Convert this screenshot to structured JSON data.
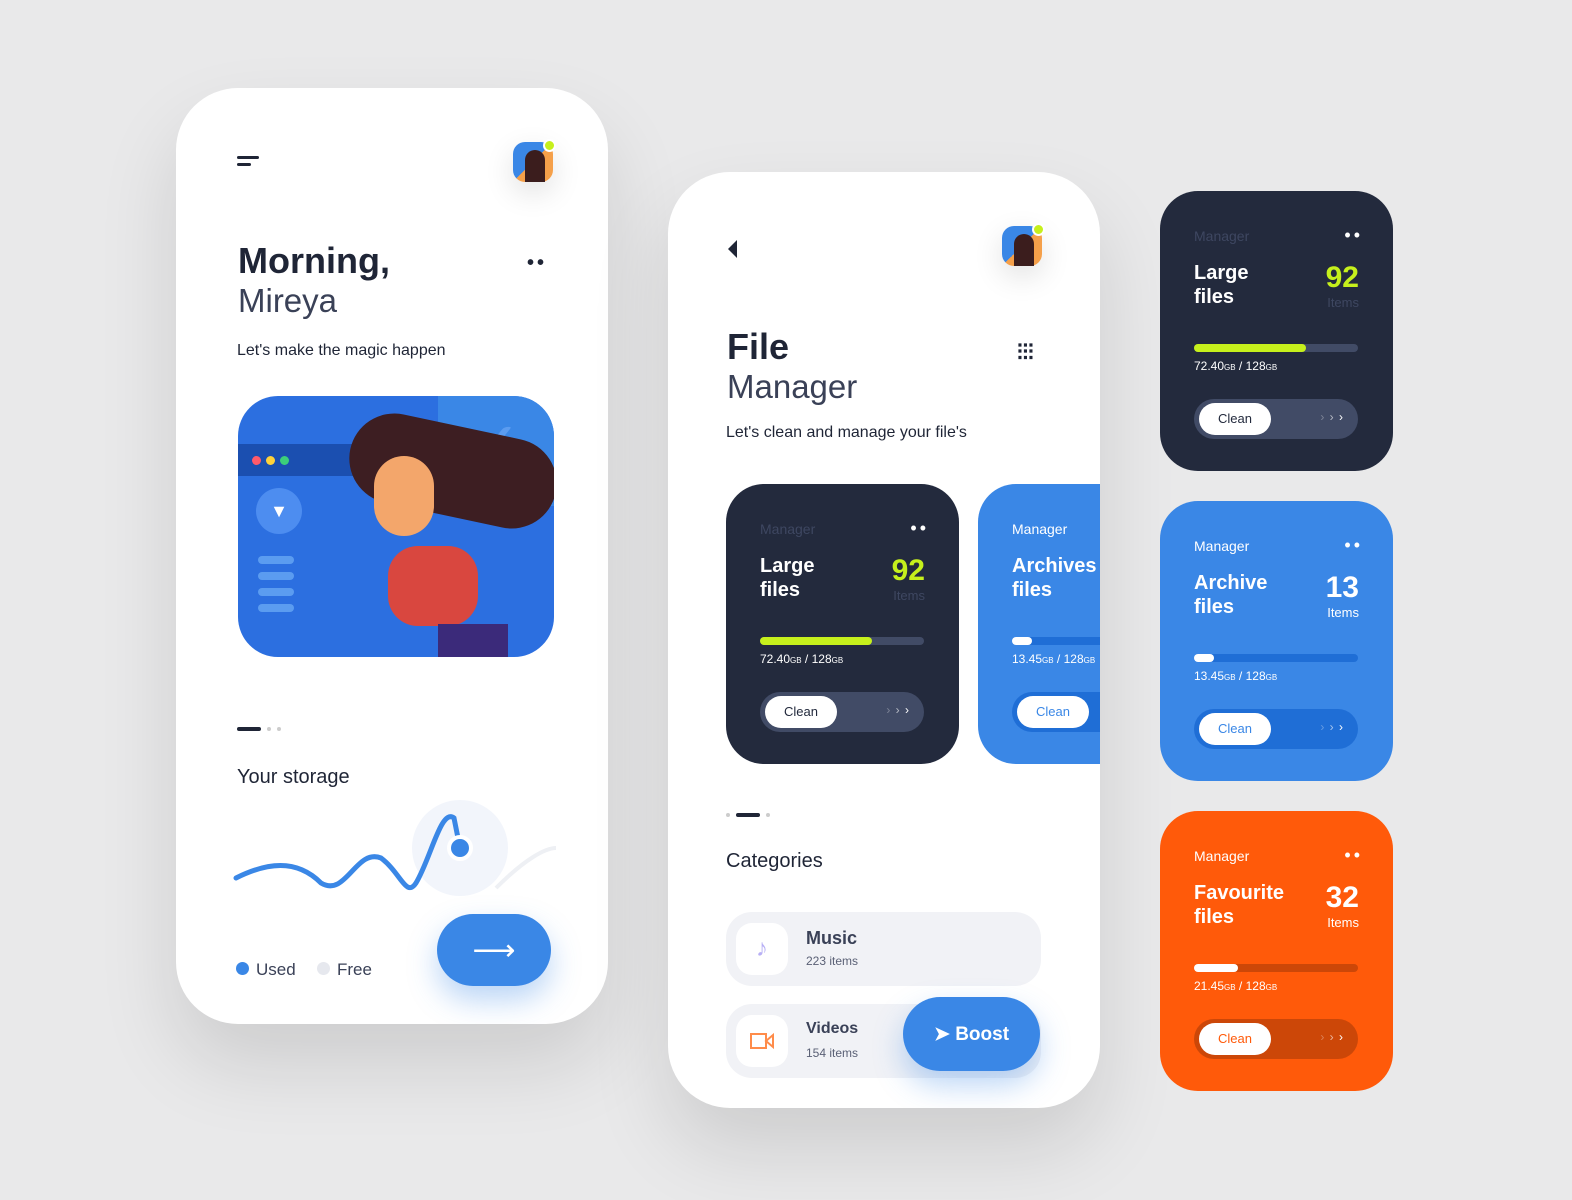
{
  "colors": {
    "dark": "#232a3d",
    "blue": "#3a87e6",
    "orange": "#ff5a0a",
    "lime": "#c6f01c"
  },
  "home": {
    "greeting_bold": "Morning,",
    "greeting_name": "Mireya",
    "subtitle": "Let's make the magic happen",
    "storage_title": "Your storage",
    "legend": [
      {
        "label": "Used",
        "color": "#3a87e6"
      },
      {
        "label": "Free",
        "color": "#e6e8ee"
      }
    ],
    "icons": {
      "menu": "menu-icon",
      "next": "arrow-right-icon",
      "more": "more-dots-icon"
    },
    "pager_active": 0
  },
  "manager": {
    "title_bold": "File",
    "title_light": "Manager",
    "subtitle": "Let's clean and manage your file's",
    "categories_title": "Categories",
    "categories": [
      {
        "name": "Music",
        "count": "223 items",
        "icon": "music-note-icon"
      },
      {
        "name": "Videos",
        "count": "154 items",
        "icon": "video-camera-icon"
      }
    ],
    "boost_label": "Boost",
    "pager_active": 1,
    "icons": {
      "back": "back-icon",
      "filter": "sliders-icon"
    }
  },
  "cards": [
    {
      "label": "Manager",
      "title1": "Large",
      "title2": "files",
      "count": "92",
      "unit": "Items",
      "used": "72.40",
      "total": "128",
      "gb": "GB",
      "fill": 0.68,
      "clean": "Clean",
      "theme": "dark"
    },
    {
      "label": "Manager",
      "title1": "Archives",
      "title2": "files",
      "count": "13",
      "unit": "Items",
      "used": "13.45",
      "total": "128",
      "gb": "GB",
      "fill": 0.12,
      "clean": "Clean",
      "theme": "blue"
    },
    {
      "label": "Manager",
      "title1": "Large",
      "title2": "files",
      "count": "92",
      "unit": "Items",
      "used": "72.40",
      "total": "128",
      "gb": "GB",
      "fill": 0.68,
      "clean": "Clean",
      "theme": "dark"
    },
    {
      "label": "Manager",
      "title1": "Archive",
      "title2": "files",
      "count": "13",
      "unit": "Items",
      "used": "13.45",
      "total": "128",
      "gb": "GB",
      "fill": 0.12,
      "clean": "Clean",
      "theme": "blue"
    },
    {
      "label": "Manager",
      "title1": "Favourite",
      "title2": "files",
      "count": "32",
      "unit": "Items",
      "used": "21.45",
      "total": "128",
      "gb": "GB",
      "fill": 0.27,
      "clean": "Clean",
      "theme": "orange"
    }
  ]
}
